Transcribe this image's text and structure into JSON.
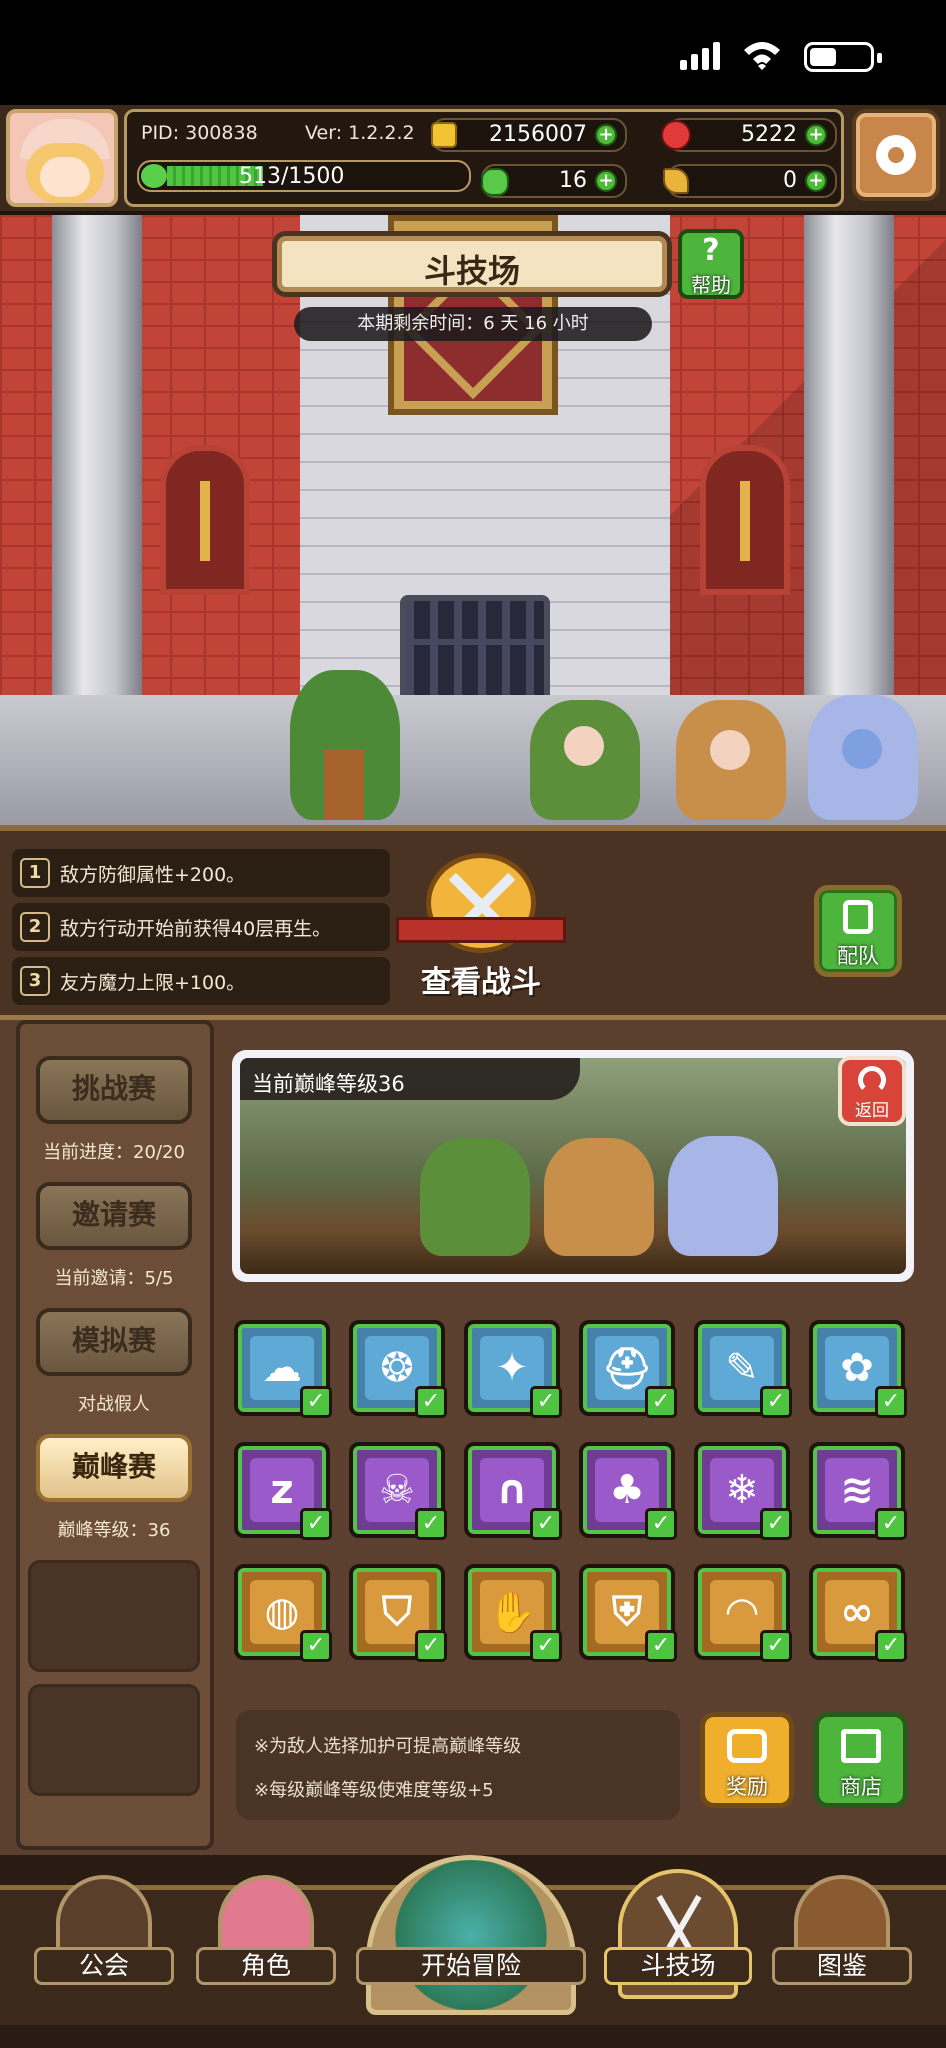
{
  "player": {
    "pid": "PID: 300838",
    "version": "Ver: 1.2.2.2",
    "xp": "513/1500",
    "xp_fraction": 0.342
  },
  "currencies": {
    "gold": "2156007",
    "gems": "5222",
    "clover": "16",
    "keys": "0"
  },
  "arena": {
    "title": "斗技场",
    "help_label": "帮助",
    "time_left": "本期剩余时间：6 天 16 小时"
  },
  "buffs": [
    {
      "num": "1",
      "text": "敌方防御属性+200。"
    },
    {
      "num": "2",
      "text": "敌方行动开始前获得40层再生。"
    },
    {
      "num": "3",
      "text": "友方魔力上限+100。"
    }
  ],
  "actions": {
    "watch_battle": "查看战斗",
    "team": "配队",
    "back": "返回",
    "reward": "奖励",
    "shop": "商店"
  },
  "modes": [
    {
      "label": "挑战赛",
      "caption": "当前进度：20/20"
    },
    {
      "label": "邀请赛",
      "caption": "当前邀请：5/5"
    },
    {
      "label": "模拟赛",
      "caption": "对战假人"
    },
    {
      "label": "巅峰赛",
      "caption": "巅峰等级：36"
    }
  ],
  "peak": {
    "level_label": "当前巅峰等级36"
  },
  "blessings": [
    {
      "color": "blue",
      "icon": "shield-blob-icon"
    },
    {
      "color": "blue",
      "icon": "snowflake-ring-icon"
    },
    {
      "color": "blue",
      "icon": "sparkle-icon"
    },
    {
      "color": "blue",
      "icon": "helmet-icon"
    },
    {
      "color": "blue",
      "icon": "feather-icon"
    },
    {
      "color": "blue",
      "icon": "paw-icon"
    },
    {
      "color": "purple",
      "icon": "sleep-icon"
    },
    {
      "color": "purple",
      "icon": "skull-icon"
    },
    {
      "color": "purple",
      "icon": "tombstone-icon"
    },
    {
      "color": "purple",
      "icon": "mushroom-cloud-icon"
    },
    {
      "color": "purple",
      "icon": "frost-icon"
    },
    {
      "color": "purple",
      "icon": "wind-icon"
    },
    {
      "color": "orange",
      "icon": "shell-icon"
    },
    {
      "color": "orange",
      "icon": "shield-crest-icon"
    },
    {
      "color": "orange",
      "icon": "claw-icon"
    },
    {
      "color": "orange",
      "icon": "shield-icon"
    },
    {
      "color": "orange",
      "icon": "bread-icon"
    },
    {
      "color": "orange",
      "icon": "infinity-icon"
    }
  ],
  "tips": [
    "※为敌人选择加护可提高巅峰等级",
    "※每级巅峰等级使难度等级+5"
  ],
  "nav": [
    {
      "label": "公会",
      "icon": "guild-hall-icon"
    },
    {
      "label": "角色",
      "icon": "character-icon"
    },
    {
      "label": "开始冒险",
      "icon": "world-map-icon"
    },
    {
      "label": "斗技场",
      "icon": "crossed-swords-icon"
    },
    {
      "label": "图鉴",
      "icon": "book-icon"
    }
  ]
}
